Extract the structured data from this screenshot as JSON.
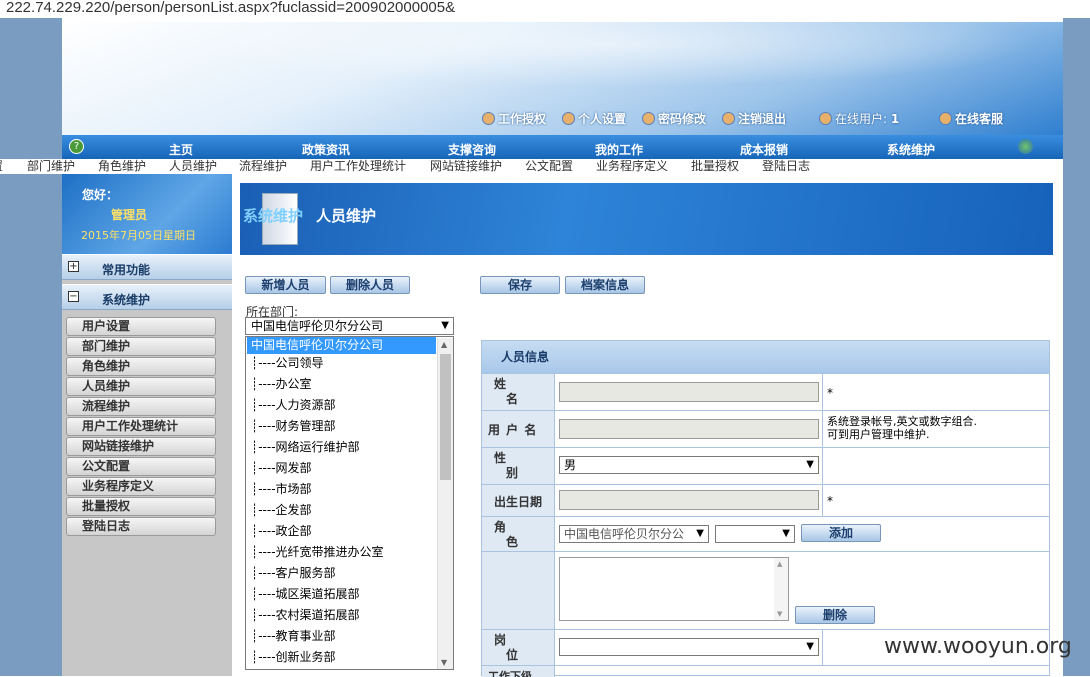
{
  "url": "222.74.229.220/person/personList.aspx?fuclassid=200902000005&",
  "toplinks": [
    {
      "icon": "user-key-icon",
      "label": "工作授权"
    },
    {
      "icon": "user-settings-icon",
      "label": "个人设置"
    },
    {
      "icon": "lock-user-icon",
      "label": "密码修改"
    },
    {
      "icon": "logout-icon",
      "label": "注销退出"
    },
    {
      "icon": "online-user-icon",
      "label": "在线用户: ",
      "value": "1"
    },
    {
      "icon": "support-icon",
      "label": "在线客服"
    }
  ],
  "nav": [
    "主页",
    "政策资讯",
    "支撑咨询",
    "我的工作",
    "成本报销",
    "系统维护"
  ],
  "subnav": [
    "置",
    "部门维护",
    "角色维护",
    "人员维护",
    "流程维护",
    "用户工作处理统计",
    "网站链接维护",
    "公文配置",
    "业务程序定义",
    "批量授权",
    "登陆日志"
  ],
  "greeting": {
    "hello": "您好：",
    "user": "管理员",
    "date": "2015年7月05日星期日"
  },
  "sidebar": {
    "categories": [
      {
        "label": "常用功能",
        "state": "+"
      },
      {
        "label": "系统维护",
        "state": "−"
      }
    ],
    "items": [
      "用户设置",
      "部门维护",
      "角色维护",
      "人员维护",
      "流程维护",
      "用户工作处理统计",
      "网站链接维护",
      "公文配置",
      "业务程序定义",
      "批量授权",
      "登陆日志"
    ]
  },
  "pagehead": {
    "section": "系统维护",
    "title": "人员维护"
  },
  "buttons": {
    "add": "新增人员",
    "delete": "删除人员",
    "save": "保存",
    "archive": "档案信息"
  },
  "dept": {
    "label": "所在部门:",
    "selected": "中国电信呼伦贝尔分公司",
    "options": [
      "中国电信呼伦贝尔分公司",
      "┊----公司领导",
      "┊----办公室",
      "┊----人力资源部",
      "┊----财务管理部",
      "┊----网络运行维护部",
      "┊----网发部",
      "┊----市场部",
      "┊----企发部",
      "┊----政企部",
      "┊----光纤宽带推进办公室",
      "┊----客户服务部",
      "┊----城区渠道拓展部",
      "┊----农村渠道拓展部",
      "┊----教育事业部",
      "┊----创新业务部"
    ]
  },
  "form": {
    "header": "人员信息",
    "name_label": "姓\n　名",
    "name_required": "*",
    "username_label": "用 户 名",
    "username_note": "系统登录帐号,英文或数字组合.\n可到用户管理中维护.",
    "gender_label": "性\n　别",
    "gender_value": "男",
    "birthday_label": "出生日期",
    "birthday_required": "*",
    "role_label": "角\n　色",
    "role_dept_value": "中国电信呼伦贝尔分公",
    "role_value": "",
    "role_add": "添加",
    "role_delete": "删除",
    "post_label": "岗\n　位",
    "post_value": "",
    "next_label": "工作下级"
  },
  "watermark": "www.wooyun.org"
}
